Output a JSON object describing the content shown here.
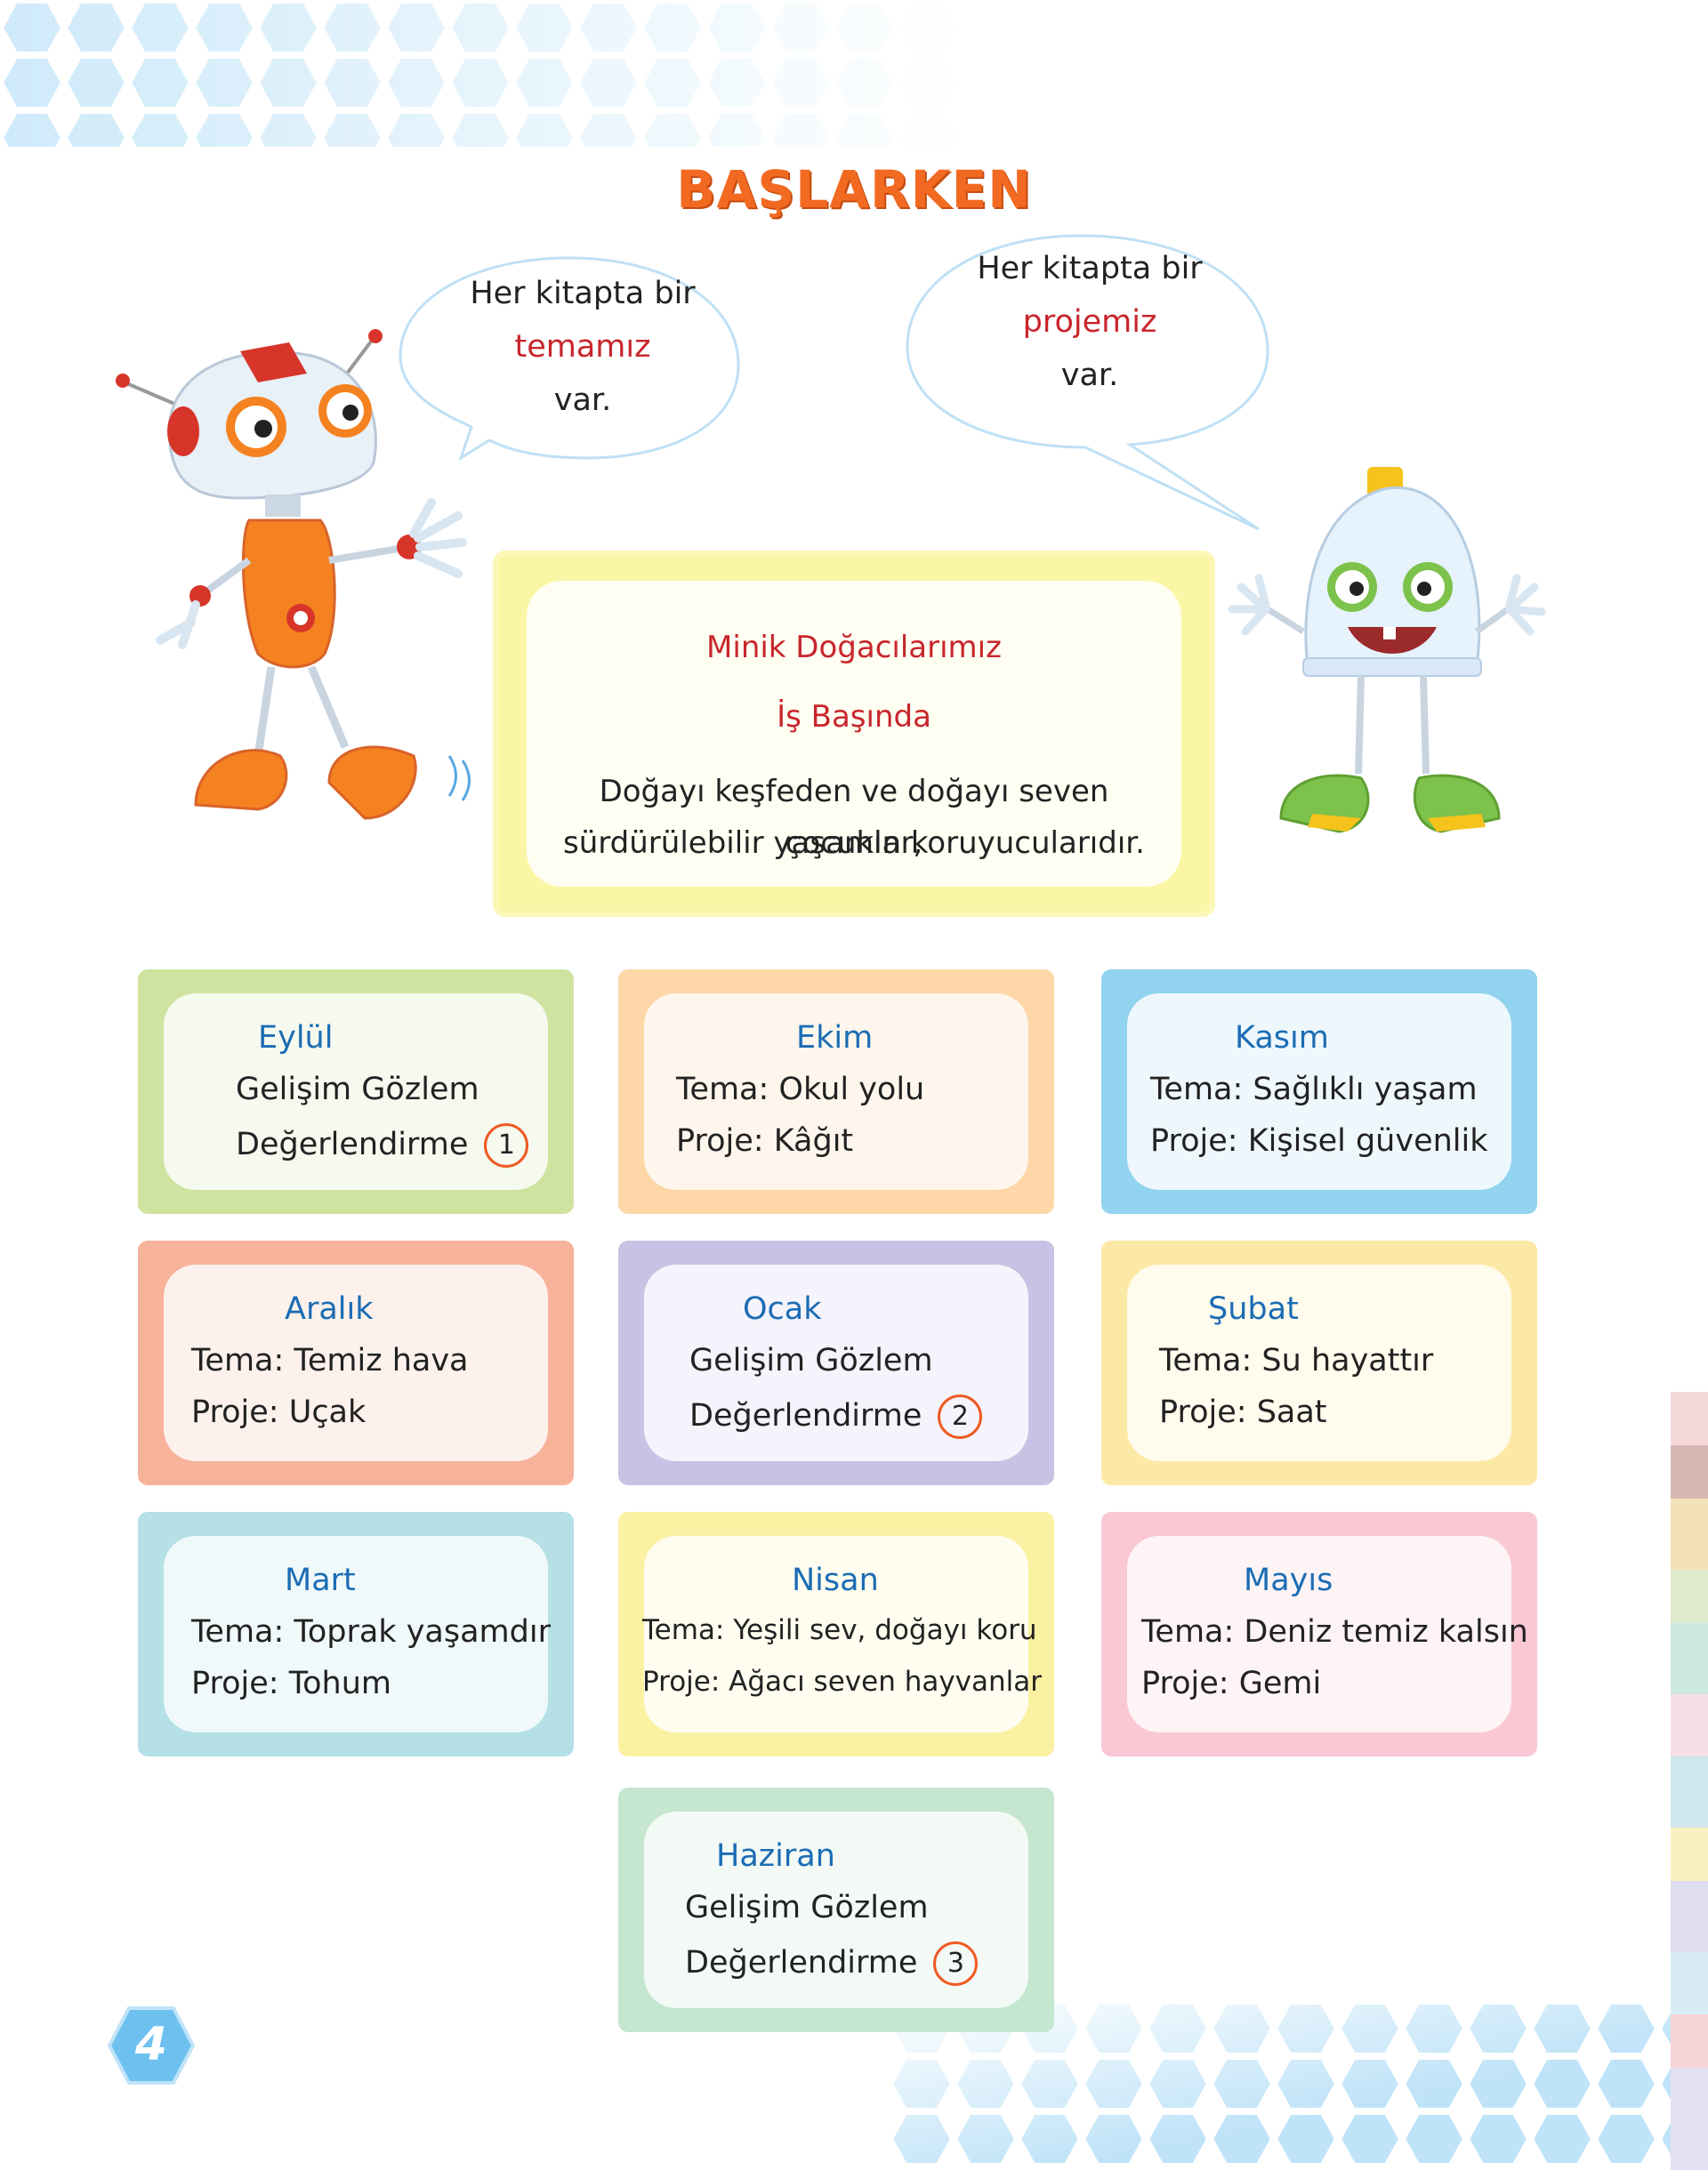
{
  "page": {
    "title": "BAŞLARKEN",
    "page_number": "4"
  },
  "bubbles": {
    "left": {
      "line1": "Her kitapta bir",
      "highlight": "temamız",
      "line3": "var."
    },
    "right": {
      "line1": "Her kitapta bir",
      "highlight": "projemiz",
      "line3": "var."
    }
  },
  "intro": {
    "heading1": "Minik Doğacılarımız",
    "heading2": "İş Başında",
    "text_line1": "Doğayı keşfeden ve doğayı seven çocuklar,",
    "text_line2": "sürdürülebilir yaşamın koruyucularıdır."
  },
  "cards": [
    {
      "month": "Eylül",
      "line1": "Gelişim Gözlem",
      "line2": "Değerlendirme",
      "badge": "1",
      "color": "#cfe3a0",
      "inner": "#f6f9ee"
    },
    {
      "month": "Ekim",
      "line1": "Tema: Okul yolu",
      "line2": "Proje:  Kâğıt",
      "color": "#fdd7a8",
      "inner": "#fef6ec"
    },
    {
      "month": "Kasım",
      "line1": "Tema: Sağlıklı yaşam",
      "line2": "Proje:  Kişisel güvenlik",
      "color": "#92d3ef",
      "inner": "#eef8fc"
    },
    {
      "month": "Aralık",
      "line1": "Tema: Temiz hava",
      "line2": "Proje:  Uçak",
      "color": "#f7b29a",
      "inner": "#fdf1ec"
    },
    {
      "month": "Ocak",
      "line1": "Gelişim Gözlem",
      "line2": "Değerlendirme",
      "badge": "2",
      "color": "#c9c2e4",
      "inner": "#f5f3fb"
    },
    {
      "month": "Şubat",
      "line1": "Tema: Su hayattır",
      "line2": "Proje: Saat",
      "color": "#fde9a6",
      "inner": "#fffbed"
    },
    {
      "month": "Mart",
      "line1": "Tema: Toprak yaşamdır",
      "line2": "Proje: Tohum",
      "color": "#b4e0e6",
      "inner": "#f0f9fa"
    },
    {
      "month": "Nisan",
      "line1": "Tema: Yeşili sev, doğayı koru",
      "line2": "Proje:  Ağacı seven hayvanlar",
      "color": "#fbf1a3",
      "inner": "#fffdef"
    },
    {
      "month": "Mayıs",
      "line1": "Tema: Deniz temiz kalsın",
      "line2": "Proje: Gemi",
      "color": "#f9c8d4",
      "inner": "#fef4f6"
    },
    {
      "month": "Haziran",
      "line1": "Gelişim Gözlem",
      "line2": "Değerlendirme",
      "badge": "3",
      "color": "#c5e6cf",
      "inner": "#f3faf5"
    }
  ],
  "colors": {
    "title": "#f26a21",
    "month": "#1b6cb4",
    "highlight": "#c8252c",
    "badge_ring": "#ee5a24",
    "hex": "#a9d8f5"
  }
}
